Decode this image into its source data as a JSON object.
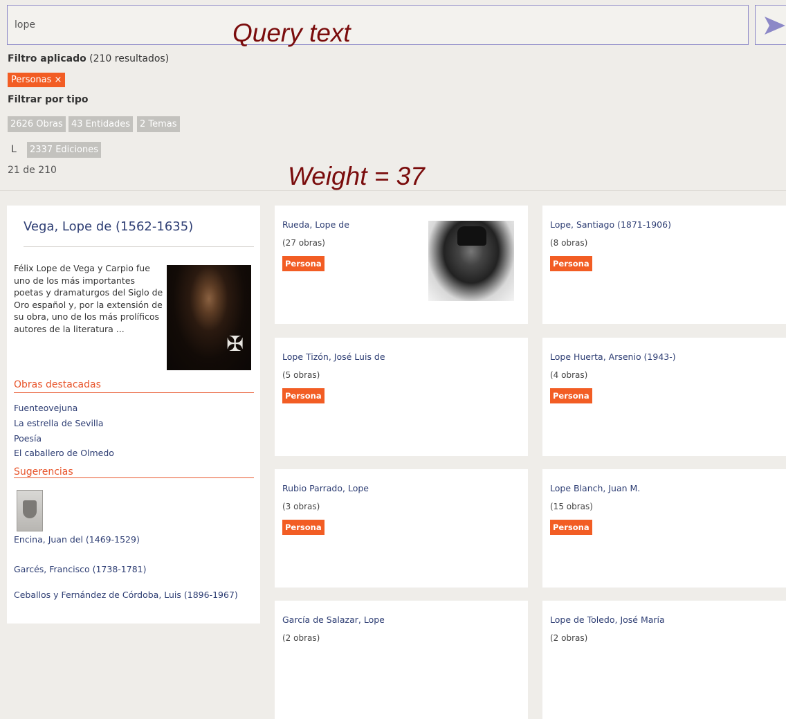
{
  "search": {
    "value": "lope"
  },
  "annotations": {
    "query_text": "Query text",
    "weight": "Weight = 37"
  },
  "filters": {
    "applied_label": "Filtro aplicado",
    "applied_count": "(210 resultados)",
    "active_chip": "Personas ×",
    "type_label": "Filtrar por tipo",
    "type_chips": [
      "2626 Obras",
      "43 Entidades",
      "2 Temas"
    ],
    "sub_bullet": "L",
    "sub_chip": "2337 Ediciones",
    "result_count": "21 de 210"
  },
  "featured": {
    "title": "Vega, Lope de (1562-1635)",
    "description": "Félix Lope de Vega y Carpio fue uno de los más importantes poetas y dramaturgos del Siglo de Oro español y, por la extensión de su obra, uno de los más prolíficos autores de la literatura ...",
    "works_heading": "Obras destacadas",
    "works": [
      "Fuenteovejuna",
      "La estrella de Sevilla",
      "Poesía",
      "El caballero de Olmedo"
    ],
    "suggestions_heading": "Sugerencias",
    "suggestions": [
      "Encina, Juan del (1469-1529)",
      "Garcés, Francisco (1738-1781)",
      "Ceballos y Fernández de Córdoba, Luis (1896-1967)"
    ]
  },
  "results": [
    {
      "name": "Rueda, Lope de",
      "works": "(27 obras)",
      "badge": "Persona",
      "has_photo": true
    },
    {
      "name": "Lope, Santiago (1871-1906)",
      "works": "(8 obras)",
      "badge": "Persona"
    },
    {
      "name": "Lope Tizón, José Luis de",
      "works": "(5 obras)",
      "badge": "Persona"
    },
    {
      "name": "Lope Huerta, Arsenio (1943-)",
      "works": "(4 obras)",
      "badge": "Persona"
    },
    {
      "name": "Rubio Parrado, Lope",
      "works": "(3 obras)",
      "badge": "Persona"
    },
    {
      "name": "Lope Blanch, Juan M.",
      "works": "(15 obras)",
      "badge": "Persona"
    },
    {
      "name": "García de Salazar, Lope",
      "works": "(2 obras)"
    },
    {
      "name": "Lope de Toledo, José María",
      "works": "(2 obras)"
    }
  ],
  "colors": {
    "accent": "#f25d24",
    "link": "#2d3d73",
    "annotation": "#7a0c0c",
    "search_border": "#8c88c7",
    "chip_grey": "#c3c2be"
  }
}
